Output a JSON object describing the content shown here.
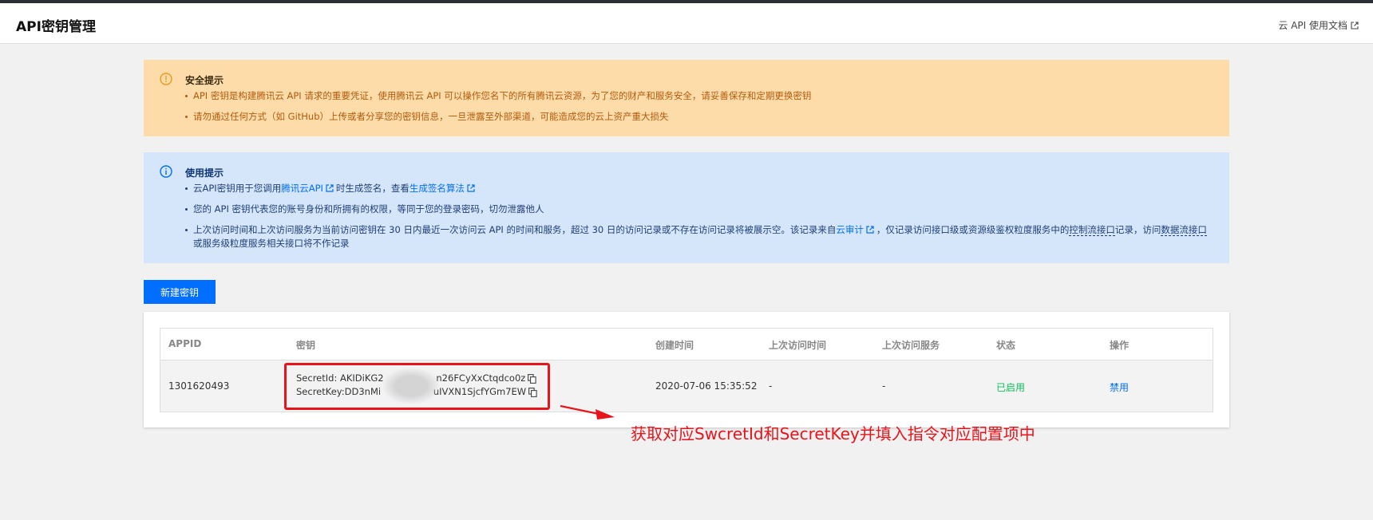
{
  "header": {
    "title": "API密钥管理",
    "doc_link": "云 API 使用文档"
  },
  "security_notice": {
    "title": "安全提示",
    "items": [
      "API 密钥是构建腾讯云 API 请求的重要凭证，使用腾讯云 API 可以操作您名下的所有腾讯云资源，为了您的财产和服务安全，请妥善保存和定期更换密钥",
      "请勿通过任何方式（如 GitHub）上传或者分享您的密钥信息，一旦泄露至外部渠道，可能造成您的云上资产重大损失"
    ]
  },
  "usage_notice": {
    "title": "使用提示",
    "item1": {
      "pre": "云API密钥用于您调用",
      "link1": "腾讯云API",
      "mid": "时生成签名，查看",
      "link2": "生成签名算法"
    },
    "item2": "您的 API 密钥代表您的账号身份和所拥有的权限，等同于您的登录密码，切勿泄露他人",
    "item3": {
      "pre": "上次访问时间和上次访问服务为当前访问密钥在 30 日内最近一次访问云 API 的时间和服务，超过 30 日的访问记录或不存在访问记录将被展示空。该记录来自",
      "link": "云审计",
      "mid": "，仅记录访问接口级或资源级鉴权粒度服务中的",
      "term1": "控制流接口",
      "mid2": "记录，访问",
      "term2": "数据流接口",
      "post": "或服务级粒度服务相关接口将不作记录"
    }
  },
  "new_key_button": "新建密钥",
  "table": {
    "columns": [
      "APPID",
      "密钥",
      "创建时间",
      "上次访问时间",
      "上次访问服务",
      "状态",
      "操作"
    ],
    "rows": [
      {
        "appid": "1301620493",
        "secret_id": "SecretId: AKIDiKG2                  n26FCyXxCtqdco0z",
        "secret_key": "SecretKey:DD3nMi                  uIVXN1SjcfYGm7EW",
        "created": "2020-07-06 15:35:52",
        "last_access_time": "-",
        "last_access_service": "-",
        "status": "已启用",
        "action": "禁用"
      }
    ]
  },
  "annotation": "获取对应SwcretId和SecretKey并填入指令对应配置项中",
  "colors": {
    "primary": "#006eff",
    "status_enabled": "#0abf5b",
    "annotation_red": "#e8141c",
    "warn_bg": "#fddcaa",
    "info_bg": "#d5e6fb"
  }
}
